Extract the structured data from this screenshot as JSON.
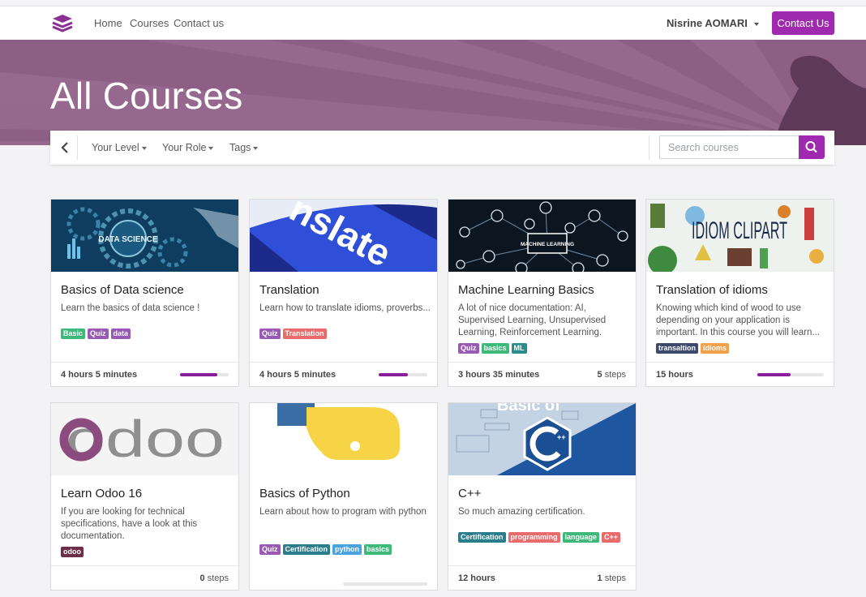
{
  "nav": {
    "links": [
      "Home",
      "Courses",
      "Contact us"
    ],
    "user_name": "Nisrine AOMARI",
    "contact_button": "Contact Us"
  },
  "banner": {
    "title": "All Courses"
  },
  "filters": {
    "level": "Your Level",
    "role": "Your Role",
    "tags": "Tags",
    "search_placeholder": "Search courses"
  },
  "colors": {
    "accent": "#a02aaf",
    "banner": "#8e5f85",
    "progress": "#8a1f9c"
  },
  "courses": [
    {
      "title": "Basics of Data science",
      "description": "Learn the basics of data science !",
      "image_text": "DATA SCIENCE",
      "tags": [
        {
          "label": "Basic",
          "color": "#3fb97a"
        },
        {
          "label": "Quiz",
          "color": "#9b59b6"
        },
        {
          "label": "data",
          "color": "#9b59b6"
        }
      ],
      "duration": "4 hours 5 minutes",
      "steps_count": "",
      "steps_label": "",
      "progress": 0.77
    },
    {
      "title": "Translation",
      "description": "Learn how to translate idioms, proverbs...",
      "image_text": "nslate",
      "tags": [
        {
          "label": "Quiz",
          "color": "#9b59b6"
        },
        {
          "label": "Translation",
          "color": "#e96b6b"
        }
      ],
      "duration": "4 hours 5 minutes",
      "steps_count": "",
      "steps_label": "",
      "progress": 0.6
    },
    {
      "title": "Machine Learning Basics",
      "description": "A lot of nice documentation: AI, Supervised Learning, Unsupervised Learning, Reinforcement Learning.",
      "image_text": "MACHINE LEARNING",
      "tags": [
        {
          "label": "Quiz",
          "color": "#9b59b6"
        },
        {
          "label": "basics",
          "color": "#3fb97a"
        },
        {
          "label": "ML",
          "color": "#2a8c8c"
        }
      ],
      "duration": "3 hours 35 minutes",
      "steps_count": "5",
      "steps_label": "steps",
      "progress": null
    },
    {
      "title": "Translation of idioms",
      "description": "Knowing which kind of wood to use depending on your application is important. In this course you will learn...",
      "image_text": "IDIOM CLIPART",
      "tags": [
        {
          "label": "transaltion",
          "color": "#3d4a6b"
        },
        {
          "label": "idioms",
          "color": "#f0a14a"
        }
      ],
      "duration": "15 hours",
      "steps_count": "",
      "steps_label": "",
      "progress": 0.5
    },
    {
      "title": "Learn Odoo 16",
      "description": "If you are looking for technical specifications, have a look at this documentation.",
      "image_text": "odoo",
      "tags": [
        {
          "label": "odoo",
          "color": "#6b2f4a"
        }
      ],
      "duration": "",
      "steps_count": "0",
      "steps_label": "steps",
      "progress": null
    },
    {
      "title": "Basics of Python",
      "description": "Learn about how to program with python",
      "image_text": "",
      "tags": [
        {
          "label": "Quiz",
          "color": "#9b59b6"
        },
        {
          "label": "Certification",
          "color": "#2a7d8c"
        },
        {
          "label": "python",
          "color": "#4aa3df"
        },
        {
          "label": "basics",
          "color": "#3fb97a"
        }
      ],
      "duration": "",
      "steps_count": "",
      "steps_label": "",
      "progress": 0
    },
    {
      "title": "C++",
      "description": "So much amazing certification.",
      "image_text": "Basic of",
      "tags": [
        {
          "label": "Certification",
          "color": "#2a7d8c"
        },
        {
          "label": "programming",
          "color": "#e96b6b"
        },
        {
          "label": "language",
          "color": "#3fb97a"
        },
        {
          "label": "C++",
          "color": "#e96b6b"
        }
      ],
      "duration": "12 hours",
      "steps_count": "1",
      "steps_label": "steps",
      "progress": null
    }
  ]
}
